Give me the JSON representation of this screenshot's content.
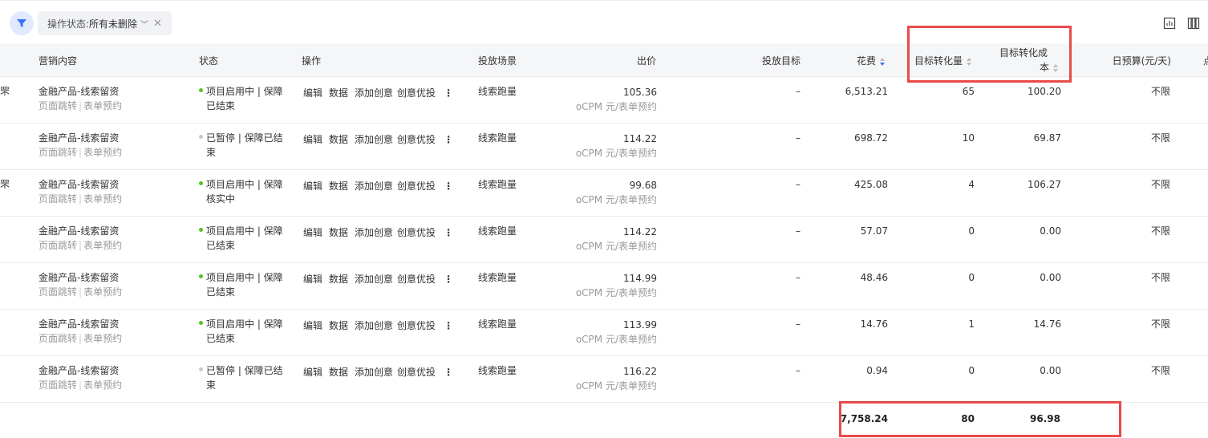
{
  "filter": {
    "label": "操作状态:",
    "value": "所有未删除"
  },
  "columns": {
    "content": "营销内容",
    "status": "状态",
    "ops": "操作",
    "scene": "投放场景",
    "bid": "出价",
    "target": "投放目标",
    "cost": "花费",
    "conv": "目标转化量",
    "conv_cost_line1": "目标转化成",
    "conv_cost_line2": "本",
    "budget": "日预算(元/天)",
    "cut": "点"
  },
  "ops": {
    "edit": "编辑",
    "data": "数据",
    "add": "添加创意",
    "optimize": "创意优投",
    "more": "⋮"
  },
  "rows": [
    {
      "edge": "罘",
      "title": "金融产品-线索留资",
      "sub1": "页面跳转",
      "sub2": "表单预约",
      "status_color": "#52c41a",
      "status1": "项目启用中 | 保障",
      "status2": "已结束",
      "scene": "线索跑量",
      "bid": "105.36",
      "bid_unit": "oCPM 元/表单预约",
      "target": "–",
      "cost": "6,513.21",
      "conv": "65",
      "conv_cost": "100.20",
      "budget": "不限"
    },
    {
      "edge": "",
      "title": "金融产品-线索留资",
      "sub1": "页面跳转",
      "sub2": "表单预约",
      "status_color": "#c8c8c8",
      "status1": "已暂停 | 保障已结",
      "status2": "束",
      "scene": "线索跑量",
      "bid": "114.22",
      "bid_unit": "oCPM 元/表单预约",
      "target": "–",
      "cost": "698.72",
      "conv": "10",
      "conv_cost": "69.87",
      "budget": "不限"
    },
    {
      "edge": "罘",
      "title": "金融产品-线索留资",
      "sub1": "页面跳转",
      "sub2": "表单预约",
      "status_color": "#52c41a",
      "status1": "项目启用中 | 保障",
      "status2": "核实中",
      "scene": "线索跑量",
      "bid": "99.68",
      "bid_unit": "oCPM 元/表单预约",
      "target": "–",
      "cost": "425.08",
      "conv": "4",
      "conv_cost": "106.27",
      "budget": "不限"
    },
    {
      "edge": "",
      "title": "金融产品-线索留资",
      "sub1": "页面跳转",
      "sub2": "表单预约",
      "status_color": "#52c41a",
      "status1": "项目启用中 | 保障",
      "status2": "已结束",
      "scene": "线索跑量",
      "bid": "114.22",
      "bid_unit": "oCPM 元/表单预约",
      "target": "–",
      "cost": "57.07",
      "conv": "0",
      "conv_cost": "0.00",
      "budget": "不限"
    },
    {
      "edge": "",
      "title": "金融产品-线索留资",
      "sub1": "页面跳转",
      "sub2": "表单预约",
      "status_color": "#52c41a",
      "status1": "项目启用中 | 保障",
      "status2": "已结束",
      "scene": "线索跑量",
      "bid": "114.99",
      "bid_unit": "oCPM 元/表单预约",
      "target": "–",
      "cost": "48.46",
      "conv": "0",
      "conv_cost": "0.00",
      "budget": "不限"
    },
    {
      "edge": "",
      "title": "金融产品-线索留资",
      "sub1": "页面跳转",
      "sub2": "表单预约",
      "status_color": "#52c41a",
      "status1": "项目启用中 | 保障",
      "status2": "已结束",
      "scene": "线索跑量",
      "bid": "113.99",
      "bid_unit": "oCPM 元/表单预约",
      "target": "–",
      "cost": "14.76",
      "conv": "1",
      "conv_cost": "14.76",
      "budget": "不限"
    },
    {
      "edge": "",
      "title": "金融产品-线索留资",
      "sub1": "页面跳转",
      "sub2": "表单预约",
      "status_color": "#c8c8c8",
      "status1": "已暂停 | 保障已结",
      "status2": "束",
      "scene": "线索跑量",
      "bid": "116.22",
      "bid_unit": "oCPM 元/表单预约",
      "target": "–",
      "cost": "0.94",
      "conv": "0",
      "conv_cost": "0.00",
      "budget": "不限"
    }
  ],
  "totals": {
    "cost": "7,758.24",
    "conv": "80",
    "conv_cost": "96.98"
  },
  "colors": {
    "highlight": "#e84a4a",
    "accent": "#3b73f5",
    "active": "#52c41a",
    "paused": "#c8c8c8"
  }
}
